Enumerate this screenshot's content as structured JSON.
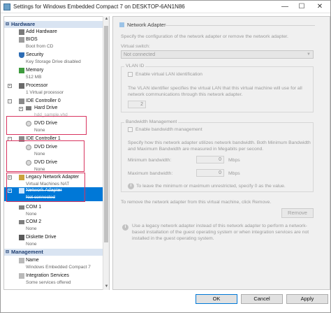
{
  "window": {
    "title": "Settings for Windows Embedded Compact 7 on DESKTOP-6AN1N86",
    "min_glyph": "—",
    "max_glyph": "☐",
    "close_glyph": "✕"
  },
  "sidebar": {
    "hardware_header": "Hardware",
    "management_header": "Management",
    "collapse_glyph": "⊟",
    "items": [
      {
        "label": "Add Hardware",
        "sub": ""
      },
      {
        "label": "BIOS",
        "sub": "Boot from CD"
      },
      {
        "label": "Security",
        "sub": "Key Storage Drive disabled"
      },
      {
        "label": "Memory",
        "sub": "512 MB"
      },
      {
        "label": "Processor",
        "sub": "1 Virtual processor"
      },
      {
        "label": "IDE Controller 0",
        "sub": ""
      },
      {
        "label": "Hard Drive",
        "sub": "hdd_sample.vhd"
      },
      {
        "label": "DVD Drive",
        "sub": "None"
      },
      {
        "label": "IDE Controller 1",
        "sub": ""
      },
      {
        "label": "DVD Drive",
        "sub": "None"
      },
      {
        "label": "DVD Drive",
        "sub": "None"
      },
      {
        "label": "Legacy Network Adapter",
        "sub": "Virtual Machines NAT"
      },
      {
        "label": "Network Adapter",
        "sub": "Not connected"
      },
      {
        "label": "COM 1",
        "sub": "None"
      },
      {
        "label": "COM 2",
        "sub": "None"
      },
      {
        "label": "Diskette Drive",
        "sub": "None"
      }
    ],
    "management_items": [
      {
        "label": "Name",
        "sub": "Windows Embedded Compact 7"
      },
      {
        "label": "Integration Services",
        "sub": "Some services offered"
      }
    ]
  },
  "main": {
    "section_title": "Network Adapter",
    "intro": "Specify the configuration of the network adapter or remove the network adapter.",
    "virtual_switch_label": "Virtual switch:",
    "virtual_switch_value": "Not connected",
    "vlan": {
      "legend": "VLAN ID",
      "checkbox_label": "Enable virtual LAN identification",
      "description": "The VLAN identifier specifies the virtual LAN that this virtual machine will use for all network communications through this network adapter.",
      "value": "2"
    },
    "bandwidth": {
      "legend": "Bandwidth Management",
      "checkbox_label": "Enable bandwidth management",
      "description": "Specify how this network adapter utilizes network bandwidth. Both Minimum Bandwidth and Maximum Bandwidth are measured in Megabits per second.",
      "min_label": "Minimum bandwidth:",
      "min_value": "0",
      "max_label": "Maximum bandwidth:",
      "max_value": "0",
      "unit": "Mbps",
      "info": "To leave the minimum or maximum unrestricted, specify 0 as the value."
    },
    "remove_hint": "To remove the network adapter from this virtual machine, click Remove.",
    "remove_button": "Remove",
    "legacy_info": "Use a legacy network adapter instead of this network adapter to perform a network-based installation of the guest operating system or when integration services are not installed in the guest operating system."
  },
  "footer": {
    "ok": "OK",
    "cancel": "Cancel",
    "apply": "Apply"
  },
  "colors": {
    "selection": "#0078d7",
    "highlight": "#d8345f",
    "section_header": "#d9e4f2"
  }
}
